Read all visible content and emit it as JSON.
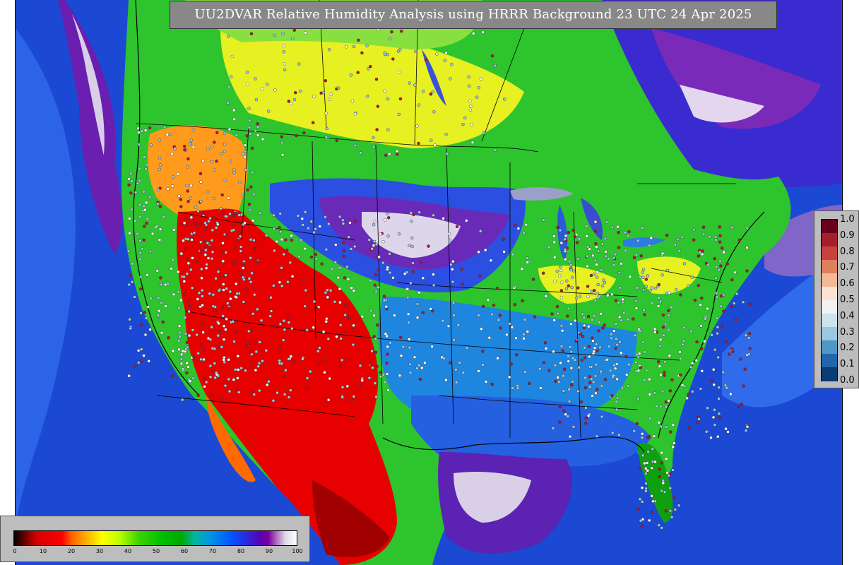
{
  "title": "UU2DVAR Relative Humidity Analysis using HRRR Background 23 UTC 24 Apr 2025",
  "right_colorbar": {
    "labels": [
      "1.0",
      "0.9",
      "0.8",
      "0.7",
      "0.6",
      "0.5",
      "0.4",
      "0.3",
      "0.2",
      "0.1",
      "0.0"
    ],
    "colors": [
      "#67001f",
      "#a51f2a",
      "#c6413f",
      "#df7f5b",
      "#f3b896",
      "#fbe2d5",
      "#f2f2f2",
      "#cde3ee",
      "#9ac8e0",
      "#4f98c4",
      "#2166ac",
      "#0a3b74"
    ]
  },
  "bottom_colorbar": {
    "labels": [
      "0",
      "10",
      "20",
      "30",
      "40",
      "50",
      "60",
      "70",
      "80",
      "90",
      "100"
    ],
    "colors": [
      "#000000",
      "#ff0000",
      "#ffff00",
      "#00c000",
      "#0055ff",
      "#5a00b4",
      "#ffffff"
    ]
  }
}
